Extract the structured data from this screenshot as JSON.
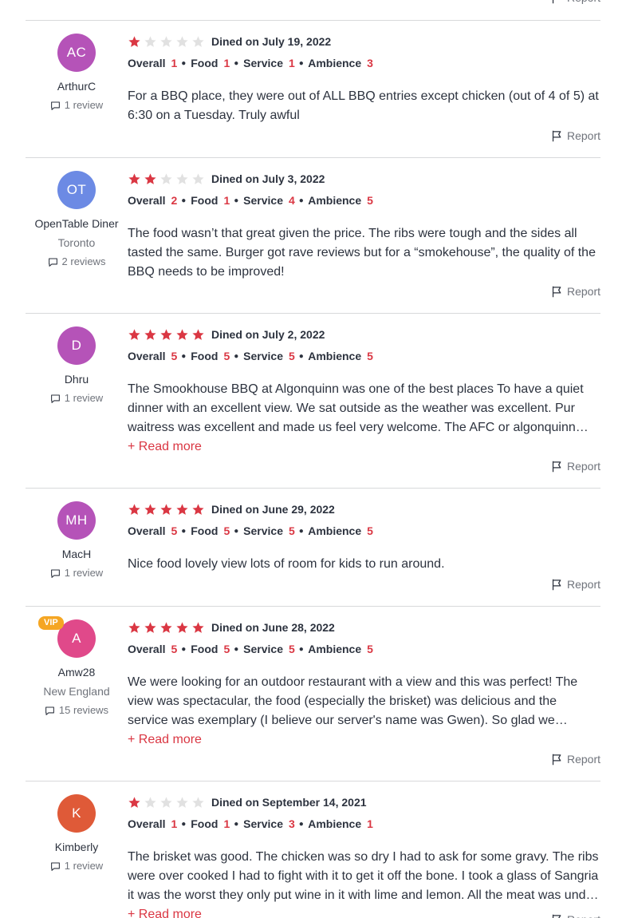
{
  "report_label": "Report",
  "reviews": [
    {
      "initials": "AC",
      "name": "ArthurC",
      "location": "",
      "review_count": "1 review",
      "vip": "",
      "avatar_color": "#b553b8",
      "stars": 1,
      "dined": "Dined on July 19, 2022",
      "overall": "1",
      "food": "1",
      "service": "1",
      "ambience": "3",
      "text": "For a BBQ place, they were out of ALL BBQ entries except chicken (out of 4 of 5) at 6:30 on a Tuesday. Truly awful",
      "read_more": ""
    },
    {
      "initials": "OT",
      "name": "OpenTable Diner",
      "location": "Toronto",
      "review_count": "2 reviews",
      "vip": "",
      "avatar_color": "#6c8ae4",
      "stars": 2,
      "dined": "Dined on July 3, 2022",
      "overall": "2",
      "food": "1",
      "service": "4",
      "ambience": "5",
      "text": "The food wasn’t that great given the price. The ribs were tough and the sides all tasted the same. Burger got rave reviews but for a “smokehouse”, the quality of the BBQ needs to be improved!",
      "read_more": ""
    },
    {
      "initials": "D",
      "name": "Dhru",
      "location": "",
      "review_count": "1 review",
      "vip": "",
      "avatar_color": "#b553b8",
      "stars": 5,
      "dined": "Dined on July 2, 2022",
      "overall": "5",
      "food": "5",
      "service": "5",
      "ambience": "5",
      "text": "The Smookhouse BBQ at Algonquinn was one of the best places To have a quiet dinner with an excellent view. We sat outside as the weather was excellent. Pur waitress was excellent and made us feel very welcome. The AFC or algonquinn fried chicken was delicious.",
      "read_more": "+ Read more"
    },
    {
      "initials": "MH",
      "name": "MacH",
      "location": "",
      "review_count": "1 review",
      "vip": "",
      "avatar_color": "#b553b8",
      "stars": 5,
      "dined": "Dined on June 29, 2022",
      "overall": "5",
      "food": "5",
      "service": "5",
      "ambience": "5",
      "text": "Nice food lovely view lots of room for kids to run around.",
      "read_more": ""
    },
    {
      "initials": "A",
      "name": "Amw28",
      "location": "New England",
      "review_count": "15 reviews",
      "vip": "VIP",
      "avatar_color": "#e0498a",
      "stars": 5,
      "dined": "Dined on June 28, 2022",
      "overall": "5",
      "food": "5",
      "service": "5",
      "ambience": "5",
      "text": "We were looking for an outdoor restaurant with a view and this was perfect! The view was spectacular, the food (especially the brisket) was delicious and the service was exemplary (I believe our server's name was Gwen). So glad we stumbled onto this place and we will be back.",
      "read_more": "+ Read more"
    },
    {
      "initials": "K",
      "name": "Kimberly",
      "location": "",
      "review_count": "1 review",
      "vip": "",
      "avatar_color": "#df5a38",
      "stars": 1,
      "dined": "Dined on September 14, 2021",
      "overall": "1",
      "food": "1",
      "service": "3",
      "ambience": "1",
      "text": "The brisket was good. The chicken was so dry I had to ask for some gravy. The ribs were over cooked I had to fight with it to get it off the bone. I took a glass of Sangria it was the worst they only put wine in it with lime and lemon. All the meat was under seasoned.",
      "read_more": "+ Read more"
    }
  ],
  "labels": {
    "overall": "Overall",
    "food": "Food",
    "service": "Service",
    "ambience": "Ambience"
  },
  "icons": {
    "star": "star-icon",
    "report": "flag-icon",
    "review_count": "speech-bubble-icon"
  },
  "colors": {
    "accent": "#da3743",
    "star_off": "#e1e1e1",
    "vip": "#f5a623"
  }
}
